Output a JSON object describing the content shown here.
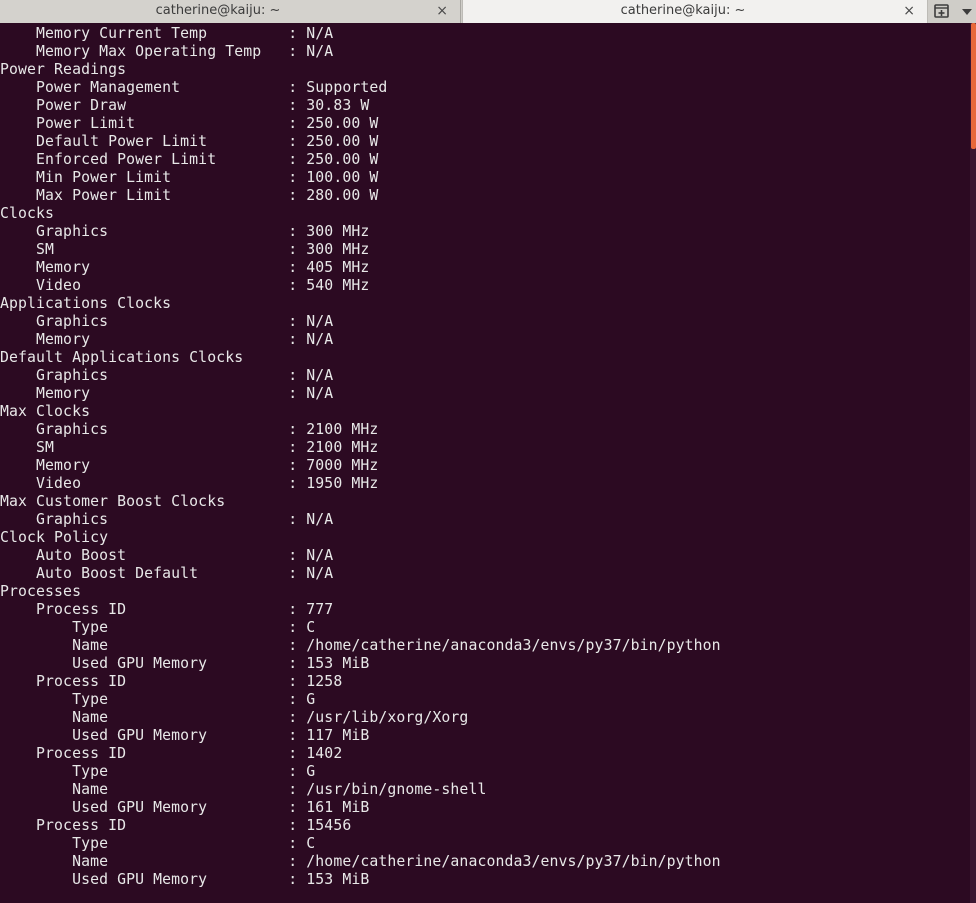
{
  "tabs": [
    {
      "title": "catherine@kaiju: ~",
      "close": "×",
      "active": false
    },
    {
      "title": "catherine@kaiju: ~",
      "close": "×",
      "active": true
    }
  ],
  "terminal": {
    "lines": [
      "    Memory Current Temp         : N/A",
      "    Memory Max Operating Temp   : N/A",
      "Power Readings",
      "    Power Management            : Supported",
      "    Power Draw                  : 30.83 W",
      "    Power Limit                 : 250.00 W",
      "    Default Power Limit         : 250.00 W",
      "    Enforced Power Limit        : 250.00 W",
      "    Min Power Limit             : 100.00 W",
      "    Max Power Limit             : 280.00 W",
      "Clocks",
      "    Graphics                    : 300 MHz",
      "    SM                          : 300 MHz",
      "    Memory                      : 405 MHz",
      "    Video                       : 540 MHz",
      "Applications Clocks",
      "    Graphics                    : N/A",
      "    Memory                      : N/A",
      "Default Applications Clocks",
      "    Graphics                    : N/A",
      "    Memory                      : N/A",
      "Max Clocks",
      "    Graphics                    : 2100 MHz",
      "    SM                          : 2100 MHz",
      "    Memory                      : 7000 MHz",
      "    Video                       : 1950 MHz",
      "Max Customer Boost Clocks",
      "    Graphics                    : N/A",
      "Clock Policy",
      "    Auto Boost                  : N/A",
      "    Auto Boost Default          : N/A",
      "Processes",
      "    Process ID                  : 777",
      "        Type                    : C",
      "        Name                    : /home/catherine/anaconda3/envs/py37/bin/python",
      "        Used GPU Memory         : 153 MiB",
      "    Process ID                  : 1258",
      "        Type                    : G",
      "        Name                    : /usr/lib/xorg/Xorg",
      "        Used GPU Memory         : 117 MiB",
      "    Process ID                  : 1402",
      "        Type                    : G",
      "        Name                    : /usr/bin/gnome-shell",
      "        Used GPU Memory         : 161 MiB",
      "    Process ID                  : 15456",
      "        Type                    : C",
      "        Name                    : /home/catherine/anaconda3/envs/py37/bin/python",
      "        Used GPU Memory         : 153 MiB"
    ]
  },
  "colors": {
    "background": "#2c0a22",
    "text": "#e8e8e8",
    "scroll_thumb": "#e8683a"
  }
}
